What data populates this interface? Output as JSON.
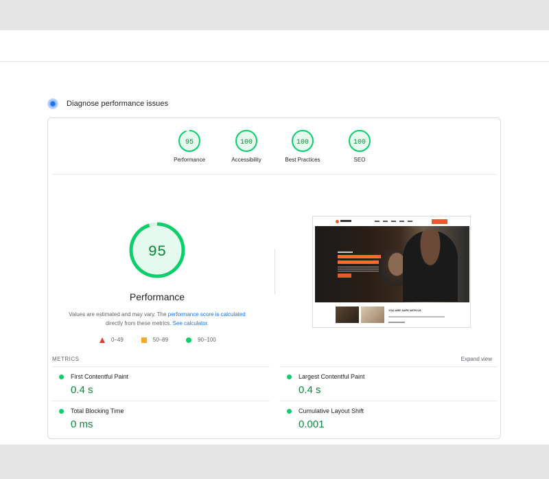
{
  "section": {
    "title": "Diagnose performance issues"
  },
  "colors": {
    "pass": "#0cce6b",
    "pass_text": "#0a8a3a",
    "average": "#f9a825",
    "fail": "#e53935",
    "link": "#1a73e8"
  },
  "scores": [
    {
      "label": "Performance",
      "value": 95
    },
    {
      "label": "Accessibility",
      "value": 100
    },
    {
      "label": "Best Practices",
      "value": 100
    },
    {
      "label": "SEO",
      "value": 100
    }
  ],
  "performance": {
    "score": "95",
    "label": "Performance",
    "note_prefix": "Values are estimated and may vary. The ",
    "note_link1": "performance score is calculated",
    "note_mid": "directly from these metrics. ",
    "note_link2": "See calculator",
    "note_suffix": "."
  },
  "legend": [
    {
      "icon": "triangle",
      "range": "0–49"
    },
    {
      "icon": "square",
      "range": "50–89"
    },
    {
      "icon": "circle",
      "range": "90–100"
    }
  ],
  "screenshot": {
    "headline": "YOU ARE SAFE WITH US"
  },
  "metrics": {
    "heading": "METRICS",
    "expand": "Expand view",
    "items": [
      {
        "name": "First Contentful Paint",
        "value": "0.4 s"
      },
      {
        "name": "Largest Contentful Paint",
        "value": "0.4 s"
      },
      {
        "name": "Total Blocking Time",
        "value": "0 ms"
      },
      {
        "name": "Cumulative Layout Shift",
        "value": "0.001"
      }
    ]
  }
}
